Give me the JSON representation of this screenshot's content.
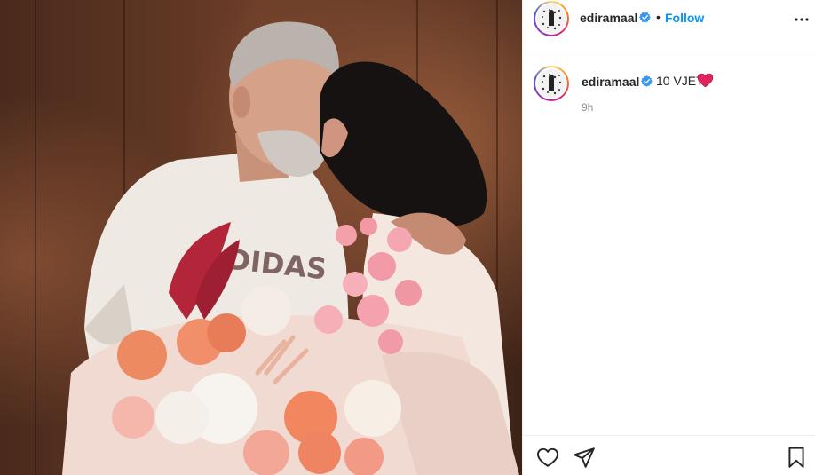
{
  "post": {
    "photo": {
      "icon": "photo-couple-kiss-flowers",
      "printed_text": "ADIDAS"
    },
    "header": {
      "username": "ediramaal",
      "verified_icon": "verified-badge-icon",
      "separator": "•",
      "follow_label": "Follow",
      "more_icon": "more-options-icon"
    },
    "caption": {
      "username": "ediramaal",
      "verified_icon": "verified-badge-icon",
      "text": "10 VJET",
      "emoji": "red-heart-icon",
      "time": "9h"
    },
    "actions": {
      "like_icon": "heart-outline-icon",
      "share_icon": "paper-plane-icon",
      "save_icon": "bookmark-icon"
    },
    "colors": {
      "link_blue": "#0095f6",
      "verified_blue": "#3897f0",
      "heart_red": "#e0245e",
      "muted_gray": "#8e8e8e",
      "divider": "#efefef"
    }
  }
}
